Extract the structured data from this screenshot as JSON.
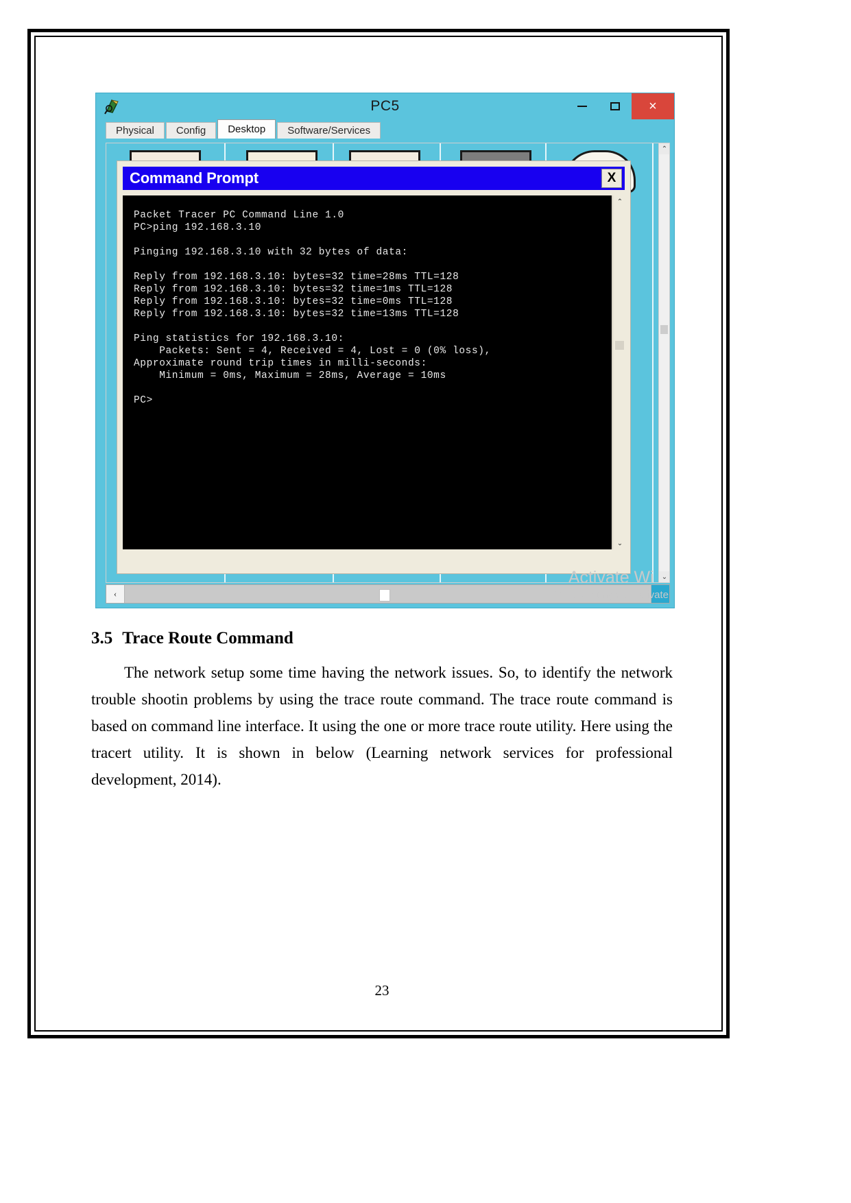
{
  "window": {
    "title": "PC5",
    "app_icon": "packet-tracer-icon",
    "controls": {
      "minimize": "–",
      "maximize": "□",
      "close": "×"
    },
    "tabs": [
      {
        "label": "Physical",
        "active": false
      },
      {
        "label": "Config",
        "active": false
      },
      {
        "label": "Desktop",
        "active": true
      },
      {
        "label": "Software/Services",
        "active": false
      }
    ],
    "scroll": {
      "up_arrow": "⌃",
      "down_arrow": "⌄",
      "left_arrow": "‹",
      "right_arrow": "›"
    }
  },
  "command_prompt": {
    "title": "Command Prompt",
    "close_label": "X",
    "scroll": {
      "up_arrow": "⌃",
      "down_arrow": "⌄"
    },
    "terminal_text": "Packet Tracer PC Command Line 1.0\nPC>ping 192.168.3.10\n\nPinging 192.168.3.10 with 32 bytes of data:\n\nReply from 192.168.3.10: bytes=32 time=28ms TTL=128\nReply from 192.168.3.10: bytes=32 time=1ms TTL=128\nReply from 192.168.3.10: bytes=32 time=0ms TTL=128\nReply from 192.168.3.10: bytes=32 time=13ms TTL=128\n\nPing statistics for 192.168.3.10:\n    Packets: Sent = 4, Received = 4, Lost = 0 (0% loss),\nApproximate round trip times in milli-seconds:\n    Minimum = 0ms, Maximum = 28ms, Average = 10ms\n\nPC>"
  },
  "watermark": {
    "line1": "Activate Wi",
    "line2": "Go to Settings to activate"
  },
  "document": {
    "section_number": "3.5",
    "section_title": "Trace Route Command",
    "paragraph": "The network setup some time having the network issues. So, to identify the network trouble shootin problems by using the trace route command. The trace route command is based on command line interface. It using the one or more trace route utility. Here using the tracert utility. It is shown in below (Learning network services for professional development, 2014).",
    "page_number": "23"
  }
}
